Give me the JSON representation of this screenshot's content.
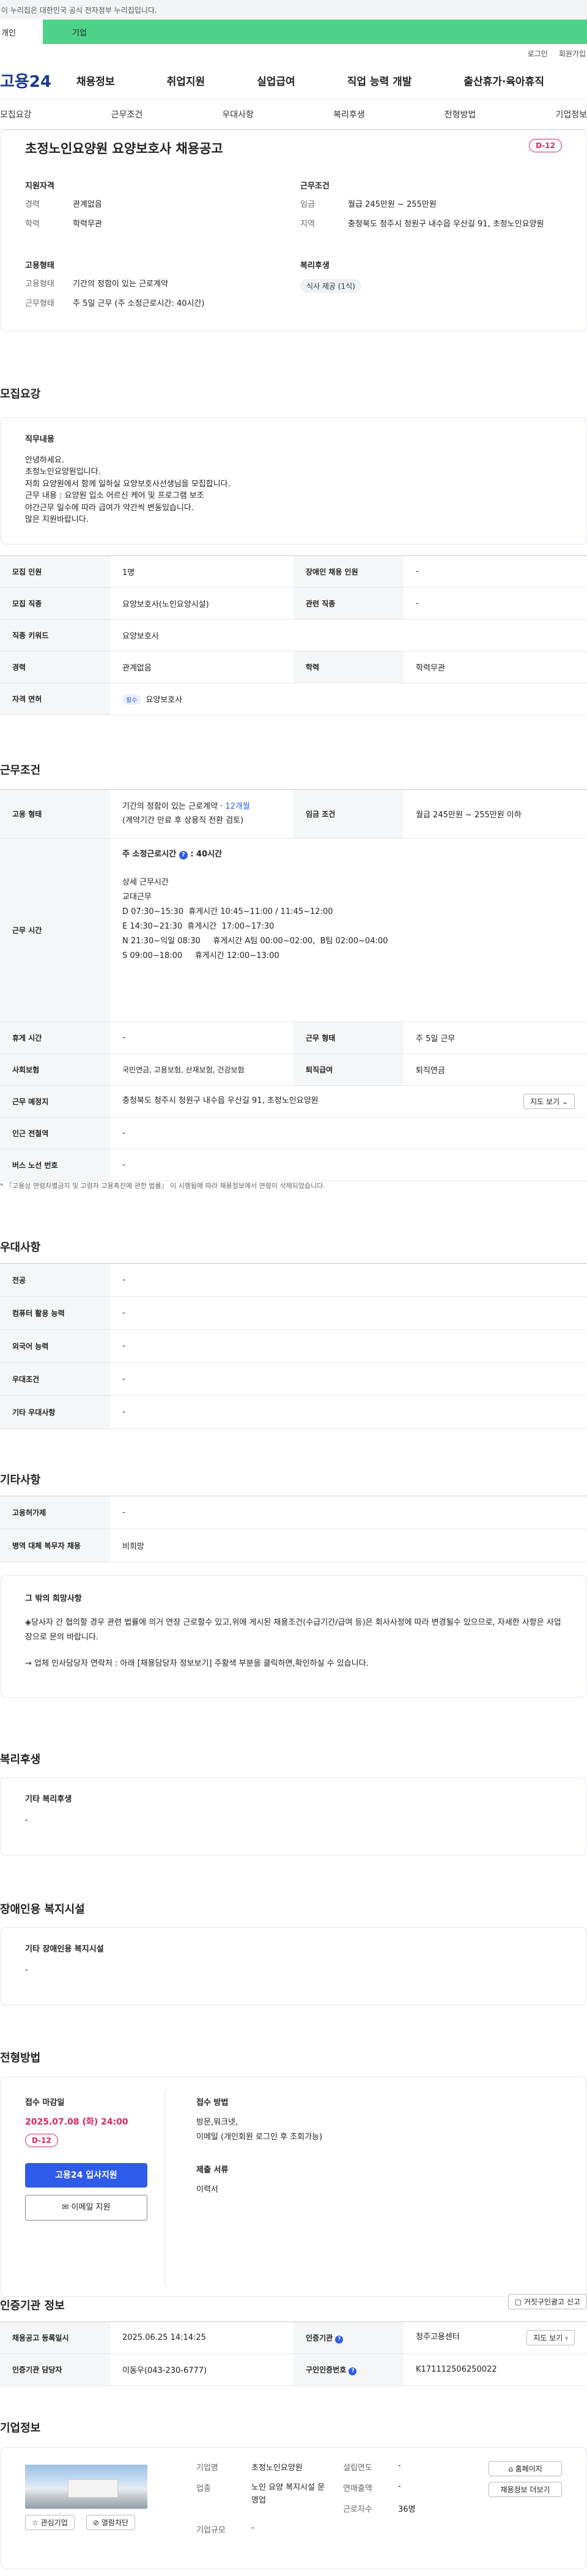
{
  "gov_banner": "이 누리집은 대한민국 공식 전자정부 누리집입니다.",
  "user_tabs": [
    "개인",
    "기업"
  ],
  "top_links": [
    "로그인",
    "회원가입"
  ],
  "logo": "고용24",
  "gnb": [
    "채용정보",
    "취업지원",
    "실업급여",
    "직업 능력 개발",
    "출산휴가·육아휴직"
  ],
  "subtabs": [
    "모집요강",
    "근무조건",
    "우대사항",
    "복리후생",
    "전형방법",
    "기업정보"
  ],
  "summary": {
    "title": "초정노인요양원 요양보호사 채용공고",
    "dday": "D-12",
    "qual_title": "지원자격",
    "career_k": "경력",
    "career_v": "관계없음",
    "edu_k": "학력",
    "edu_v": "학력무관",
    "cond_title": "근무조건",
    "wage_k": "임금",
    "wage_v": "월급 245만원 ~ 255만원",
    "loc_k": "지역",
    "loc_v": "충청북도 청주시 청원구 내수읍 우산길 91, 초정노인요양원",
    "emp_title": "고용형태",
    "emp_k": "고용형태",
    "emp_v": "기간의 정함이 있는 근로계약",
    "work_k": "근무형태",
    "work_v": "주 5일 근무 (주 소정근로시간: 40시간)",
    "welfare_title": "복리후생",
    "welfare_chip": "식사 제공 (1식)"
  },
  "recruit": {
    "title": "모집요강",
    "job_desc_title": "직무내용",
    "job_desc": [
      "안녕하세요.",
      "초정노인요양원입니다.",
      "저희 요양원에서 함께 일하실 요양보호사선생님을 모집합니다.",
      "근무 내용 : 요양원 입소 어르신 케어 및 프로그램 보조",
      "야간근무 일수에 따라 급여가 약간씩 변동있습니다.",
      "많은 지원바랍니다."
    ],
    "rows": {
      "count_k": "모집 인원",
      "count_v": "1명",
      "disabled_k": "장애인 채용 인원",
      "disabled_v": "-",
      "job_k": "모집 직종",
      "job_v": "요양보호사(노인요양시설)",
      "related_k": "관련 직종",
      "related_v": "-",
      "kw_k": "직종 키워드",
      "kw_v": "요양보호사",
      "career_k": "경력",
      "career_v": "관계없음",
      "edu_k": "학력",
      "edu_v": "학력무관",
      "license_k": "자격 면허",
      "license_tag": "필수",
      "license_v": "요양보호사"
    }
  },
  "conditions": {
    "title": "근무조건",
    "emp_k": "고용 형태",
    "emp_v1": "기간의 정함이 있는 근로계약 · ",
    "emp_v1b": "12개월",
    "emp_v2": "(계약기간 만료 후 상용직 전환 검토)",
    "wage_k": "임금 조건",
    "wage_v": "월급 245만원 ~ 255만원 이하",
    "time_k": "근무 시간",
    "time_head": "주 소정근로시간",
    "time_head2": ": 40시간",
    "time_detail_title": "상세 근무시간",
    "time_lines": [
      "교대근무",
      "D 07:30~15:30  휴게시간 10:45~11:00 / 11:45~12:00",
      "E 14:30~21:30  휴게시간  17:00~17:30",
      "N 21:30~익일 08:30     휴게시간 A팀 00:00~02:00,  B팀 02:00~04:00",
      "S 09:00~18:00     휴게시간 12:00~13:00"
    ],
    "rest_k": "휴게 시간",
    "rest_v": "-",
    "form_k": "근무 형태",
    "form_v": "주 5일 근무",
    "ins_k": "사회보험",
    "ins_v": "국민연금, 고용보험, 산재보험, 건강보험",
    "sev_k": "퇴직급여",
    "sev_v": "퇴직연금",
    "place_k": "근무 예정지",
    "place_v": "충청북도 청주시 청원구 내수읍 우산길 91, 초정노인요양원",
    "map_btn": "지도 보기",
    "station_k": "인근 전철역",
    "station_v": "-",
    "bus_k": "버스 노선 번호",
    "bus_v": "-",
    "note": "* 『고용상 연령차별금지 및 고령자 고용촉진에 관한 법률』 이 시행됨에 따라 채용정보에서 연령이 삭제되었습니다."
  },
  "pref": {
    "title": "우대사항",
    "rows": [
      [
        "전공",
        "-"
      ],
      [
        "컴퓨터 활용 능력",
        "-"
      ],
      [
        "외국어 능력",
        "-"
      ],
      [
        "우대조건",
        "-"
      ],
      [
        "기타 우대사항",
        "-"
      ]
    ]
  },
  "etc": {
    "title": "기타사항",
    "rows": [
      [
        "고용허가제",
        "-"
      ],
      [
        "병역 대체 복무자 채용",
        "비희망"
      ]
    ],
    "other_title": "그 밖의 희망사항",
    "other_p1": "◈당사자 간 협의할 경우 관련 법률에 의거 연장 근로할수 있고,위에 게시된 채용조건(수급기간/급여 등)은 회사사정에 따라 변경될수 있으므로, 자세한 사항은 사업장으로 문의 바랍니다.",
    "other_p2": "→ 업체 인사담당자 연락처 :  아래 [채용담당자 정보보기] 주황색 부분을 클릭하면,확인하실 수 있습니다."
  },
  "welfare": {
    "title": "복리후생",
    "sub": "기타 복리후생",
    "v": "-"
  },
  "disabled": {
    "title": "장애인용 복지시설",
    "sub": "기타 장애인용 복지시설",
    "v": "-"
  },
  "apply": {
    "title": "전형방법",
    "deadline_k": "접수 마감일",
    "deadline_v": "2025.07.08 (화) 24:00",
    "dday": "D-12",
    "btn_apply": "고용24 입사지원",
    "btn_email": "이메일 지원",
    "method_k": "접수 방법",
    "method_v1": "방문,워크넷,",
    "method_v2": "이메일 (개인회원 로그인 후 조회가능)",
    "docs_k": "제출 서류",
    "docs_v": "이력서"
  },
  "agency": {
    "title": "인증기관 정보",
    "report_btn": "거짓구인광고 신고",
    "reg_k": "채용공고 등록일시",
    "reg_v": "2025.06.25 14:14:25",
    "org_k": "인증기관",
    "org_v": "청주고용센터",
    "map_btn": "지도 보기",
    "mgr_k": "인증기관 담당자",
    "mgr_v": "이동우(043-230-6777)",
    "no_k": "구인인증번호",
    "no_v": "K171112506250022"
  },
  "company": {
    "title": "기업정보",
    "name_k": "기업명",
    "name_v": "초정노인요양원",
    "year_k": "설립연도",
    "year_v": "-",
    "ind_k": "업종",
    "ind_v": "노인 요양 복지시설 운영업",
    "sales_k": "연매출액",
    "sales_v": "-",
    "emp_k": "근로자수",
    "emp_v": "36명",
    "size_k": "기업규모",
    "size_v": "-",
    "btn_home": "홈페이지",
    "btn_jobs": "채용정보 더보기",
    "btn_fav": "관심기업",
    "btn_block": "열람차단"
  }
}
